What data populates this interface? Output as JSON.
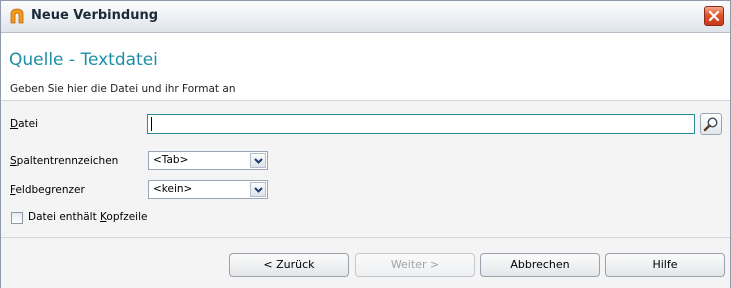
{
  "window": {
    "title": "Neue Verbindung",
    "icon": "app-icon",
    "close_icon": "close-icon"
  },
  "header": {
    "title": "Quelle - Textdatei",
    "subtitle": "Geben Sie hier die Datei und ihr Format an"
  },
  "form": {
    "file": {
      "label_mnemonic": "D",
      "label_rest": "atei",
      "value": "",
      "browse_icon": "search-icon"
    },
    "column_separator": {
      "label_mnemonic": "S",
      "label_rest": "paltentrennzeichen",
      "selected": "<Tab>"
    },
    "field_delimiter": {
      "label_mnemonic": "F",
      "label_rest": "eldbegrenzer",
      "selected": "<kein>"
    },
    "header_row": {
      "label_before": "Datei enthält ",
      "label_mnemonic": "K",
      "label_after": "opfzeile",
      "checked": false
    }
  },
  "buttons": {
    "back": "< Zurück",
    "next": "Weiter >",
    "cancel": "Abbrechen",
    "help": "Hilfe"
  }
}
